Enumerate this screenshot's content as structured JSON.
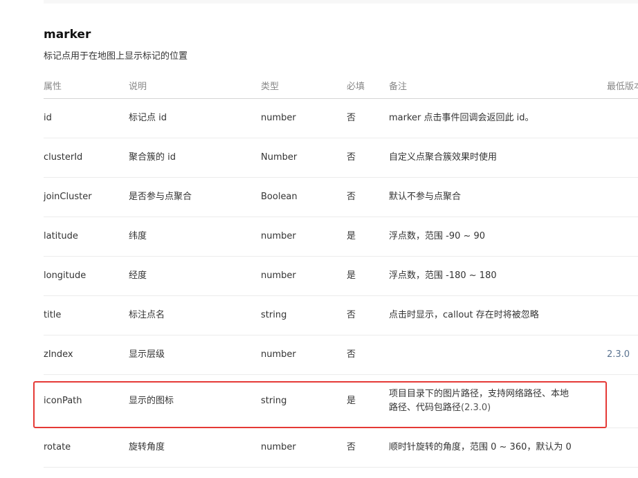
{
  "section": {
    "title": "marker",
    "description": "标记点用于在地图上显示标记的位置"
  },
  "table": {
    "headers": {
      "attr": "属性",
      "desc": "说明",
      "type": "类型",
      "required": "必填",
      "note": "备注",
      "min_version": "最低版本"
    },
    "rows": [
      {
        "attr": "id",
        "desc": "标记点 id",
        "type": "number",
        "required": "否",
        "note": "marker 点击事件回调会返回此 id。",
        "note_version": "",
        "min_version": ""
      },
      {
        "attr": "clusterId",
        "desc": "聚合簇的 id",
        "type": "Number",
        "required": "否",
        "note": "自定义点聚合簇效果时使用",
        "note_version": "",
        "min_version": ""
      },
      {
        "attr": "joinCluster",
        "desc": "是否参与点聚合",
        "type": "Boolean",
        "required": "否",
        "note": "默认不参与点聚合",
        "note_version": "",
        "min_version": ""
      },
      {
        "attr": "latitude",
        "desc": "纬度",
        "type": "number",
        "required": "是",
        "note": "浮点数，范围 -90 ~ 90",
        "note_version": "",
        "min_version": ""
      },
      {
        "attr": "longitude",
        "desc": "经度",
        "type": "number",
        "required": "是",
        "note": "浮点数，范围 -180 ~ 180",
        "note_version": "",
        "min_version": ""
      },
      {
        "attr": "title",
        "desc": "标注点名",
        "type": "string",
        "required": "否",
        "note": "点击时显示，callout 存在时将被忽略",
        "note_version": "",
        "min_version": ""
      },
      {
        "attr": "zIndex",
        "desc": "显示层级",
        "type": "number",
        "required": "否",
        "note": "",
        "note_version": "",
        "min_version": "2.3.0"
      },
      {
        "attr": "iconPath",
        "desc": "显示的图标",
        "type": "string",
        "required": "是",
        "note": "项目目录下的图片路径，支持网络路径、本地路径、代码包路径",
        "note_version": "(2.3.0)",
        "min_version": ""
      },
      {
        "attr": "rotate",
        "desc": "旋转角度",
        "type": "number",
        "required": "否",
        "note": "顺时针旋转的角度，范围 0 ~ 360，默认为 0",
        "note_version": "",
        "min_version": ""
      }
    ]
  },
  "highlight": {
    "row_attr": "iconPath",
    "color": "#e53935"
  },
  "colors": {
    "header_text": "#888888",
    "body_text": "#333333",
    "version_text": "#5a7390",
    "row_divider": "#ececec"
  }
}
